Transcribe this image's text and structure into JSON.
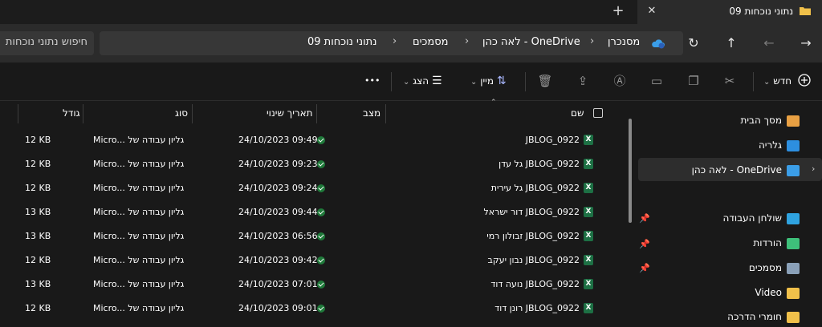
{
  "window": {
    "tab_title": "נתוני  נוכחות 09",
    "close": "✕",
    "new_tab": "+"
  },
  "nav": {
    "back": "→",
    "forward": "←",
    "up": "↑",
    "refresh": "↻",
    "breadcrumbs": [
      "מסנכרן",
      "לאה כהן - OneDrive",
      "מסמכים",
      "נתוני  נוכחות 09"
    ],
    "search_placeholder": "חיפוש נתוני  נוכחות"
  },
  "commands": {
    "new_label": "חדש",
    "sort_label": "מיין",
    "view_label": "הצג",
    "more": "•••"
  },
  "sidebar": {
    "items": [
      {
        "label": "מסך הבית",
        "icon": "home-icon",
        "color": "#e8a043"
      },
      {
        "label": "גלריה",
        "icon": "gallery-icon",
        "color": "#2d8fe0"
      },
      {
        "label": "OneDrive - לאה כהן",
        "icon": "cloud-icon",
        "color": "#3b9ee8"
      },
      {
        "label": "שולחן העבודה",
        "icon": "desktop-icon",
        "color": "#2fa3e0"
      },
      {
        "label": "הורדות",
        "icon": "download-icon",
        "color": "#3ec07a"
      },
      {
        "label": "מסמכים",
        "icon": "documents-icon",
        "color": "#8aa0b8"
      },
      {
        "label": "Video",
        "icon": "folder-icon",
        "color": "#f0c04a"
      },
      {
        "label": "חומרי הדרכה",
        "icon": "folder-icon",
        "color": "#f0c04a"
      }
    ]
  },
  "table": {
    "columns": {
      "name": "שם",
      "status": "מצב",
      "modified": "תאריך שינוי",
      "type": "סוג",
      "size": "גודל"
    },
    "rows": [
      {
        "name": "JBLOG_0922",
        "date": "24/10/2023 09:49",
        "type": "Micro... גליון עבודה של",
        "size": "12 KB"
      },
      {
        "name": "JBLOG_0922 גל עדן",
        "date": "24/10/2023 09:23",
        "type": "Micro... גליון עבודה של",
        "size": "12 KB"
      },
      {
        "name": "JBLOG_0922 גל עירית",
        "date": "24/10/2023 09:24",
        "type": "Micro... גליון עבודה של",
        "size": "12 KB"
      },
      {
        "name": "JBLOG_0922 דור ישראל",
        "date": "24/10/2023 09:44",
        "type": "Micro... גליון עבודה של",
        "size": "13 KB"
      },
      {
        "name": "JBLOG_0922 זבולון רמי",
        "date": "24/10/2023 06:56",
        "type": "Micro... גליון עבודה של",
        "size": "13 KB"
      },
      {
        "name": "JBLOG_0922 נבון יעקב",
        "date": "24/10/2023 09:42",
        "type": "Micro... גליון עבודה של",
        "size": "12 KB"
      },
      {
        "name": "JBLOG_0922 נועה דוד",
        "date": "24/10/2023 07:01",
        "type": "Micro... גליון עבודה של",
        "size": "13 KB"
      },
      {
        "name": "JBLOG_0922 רונן דוד",
        "date": "24/10/2023 09:01",
        "type": "Micro... גליון עבודה של",
        "size": "12 KB"
      }
    ]
  }
}
